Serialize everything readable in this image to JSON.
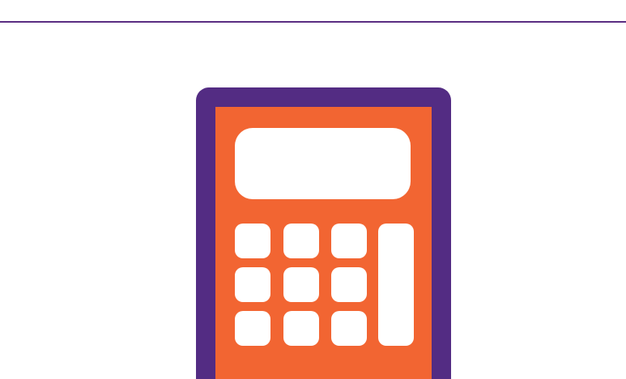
{
  "colors": {
    "rule": "#5a2d82",
    "calculator_frame": "#532c83",
    "calculator_body": "#f26532",
    "calculator_keys": "#ffffff",
    "background": "#ffffff"
  },
  "illustration": {
    "icon": "calculator-icon"
  }
}
